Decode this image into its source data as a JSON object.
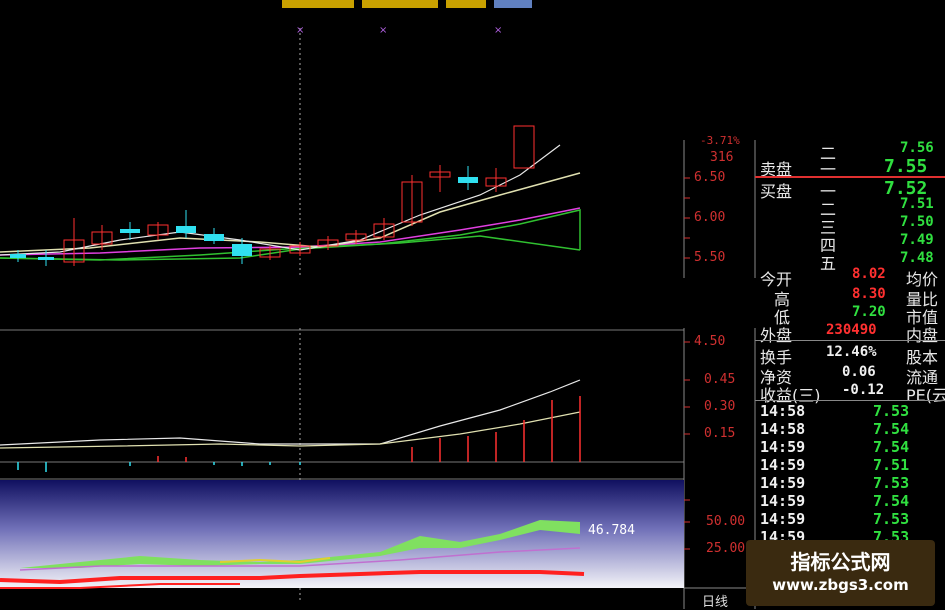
{
  "price_axis": {
    "labels": [
      "6.50",
      "6.00",
      "5.50",
      "4.50"
    ]
  },
  "header_readout": {
    "pct": "-3.71%",
    "value": "316"
  },
  "vol_axis": {
    "labels": [
      "0.45",
      "0.30",
      "0.15"
    ]
  },
  "ind_axis": {
    "labels": [
      "50.00",
      "25.00"
    ],
    "current_value": "46.784"
  },
  "period_label": "日线",
  "order_book": {
    "sell_label": "卖盘",
    "buy_label": "买盘",
    "sell": [
      {
        "rank": "二",
        "price": "7.56"
      },
      {
        "rank": "一",
        "price": "7.55"
      }
    ],
    "buy": [
      {
        "rank": "一",
        "price": "7.52"
      },
      {
        "rank": "二",
        "price": "7.51"
      },
      {
        "rank": "三",
        "price": "7.50"
      },
      {
        "rank": "四",
        "price": "7.49"
      },
      {
        "rank": "五",
        "price": "7.48"
      }
    ]
  },
  "stats": [
    {
      "label": "今开",
      "value": "8.02",
      "right": "均价"
    },
    {
      "label": "高",
      "value": "8.30",
      "right": "量比"
    },
    {
      "label": "低",
      "value": "7.20",
      "right": "市值"
    },
    {
      "label": "外盘",
      "value": "230490",
      "right": "内盘"
    },
    {
      "label": "换手",
      "value": "12.46%",
      "right": "股本"
    },
    {
      "label": "净资",
      "value": "0.06",
      "right": "流通"
    },
    {
      "label": "收益(三)",
      "value": "-0.12",
      "right": "PE(云"
    }
  ],
  "ticks": [
    {
      "time": "14:58",
      "price": "7.53"
    },
    {
      "time": "14:58",
      "price": "7.54"
    },
    {
      "time": "14:59",
      "price": "7.54"
    },
    {
      "time": "14:59",
      "price": "7.51"
    },
    {
      "time": "14:59",
      "price": "7.53"
    },
    {
      "time": "14:59",
      "price": "7.54"
    },
    {
      "time": "14:59",
      "price": "7.53"
    },
    {
      "time": "14:59",
      "price": "7.53"
    }
  ],
  "watermark": {
    "line1": "指标公式网",
    "line2": "www.zbgs3.com"
  },
  "colors": {
    "up": "#ff3030",
    "down": "#30e0f0",
    "accent": "#30e040"
  }
}
